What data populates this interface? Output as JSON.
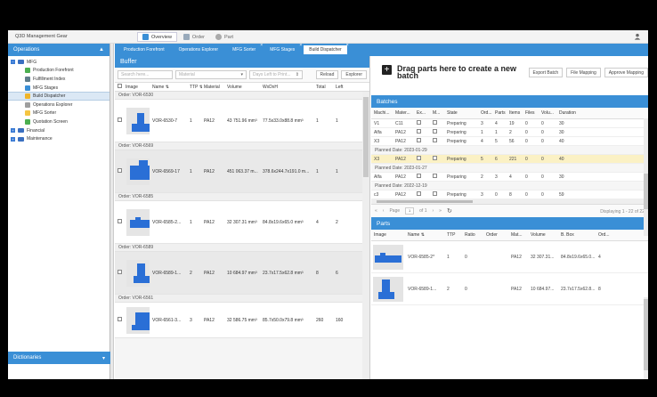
{
  "app_title": "Q3D Management Gear",
  "menu_tabs": [
    {
      "label": "Overview",
      "color": "#3a8fd6"
    },
    {
      "label": "Order",
      "color": "#9ab"
    },
    {
      "label": "Part",
      "color": "#aaa"
    }
  ],
  "sidebar": {
    "header": "Operations",
    "footer": "Dictionaries",
    "tree": [
      {
        "label": "MFG",
        "level": 0,
        "kind": "folder"
      },
      {
        "label": "Production Forefront",
        "level": 1,
        "icon": "#4caf50"
      },
      {
        "label": "Fulfillment Index",
        "level": 1,
        "icon": "#607d8b"
      },
      {
        "label": "MFG Stages",
        "level": 1,
        "icon": "#3a8fd6"
      },
      {
        "label": "Build Dispatcher",
        "level": 1,
        "icon": "#f0b429",
        "selected": true
      },
      {
        "label": "Operations Explorer",
        "level": 1,
        "icon": "#9e9e9e"
      },
      {
        "label": "MFG Sorter",
        "level": 1,
        "icon": "#f5c542"
      },
      {
        "label": "Quotation Screen",
        "level": 1,
        "icon": "#4caf50"
      },
      {
        "label": "Financial",
        "level": 0,
        "kind": "folder"
      },
      {
        "label": "Maintenance",
        "level": 0,
        "kind": "folder"
      }
    ]
  },
  "tabs": [
    {
      "label": "Production Forefront",
      "active": false
    },
    {
      "label": "Operations Explorer",
      "active": false
    },
    {
      "label": "MFG Sorter",
      "active": false
    },
    {
      "label": "MFG Stages",
      "active": false
    },
    {
      "label": "Build Dispatcher",
      "active": true
    }
  ],
  "buffer": {
    "title": "Buffer",
    "search_placeholder": "Search here...",
    "material_placeholder": "Material",
    "days_placeholder": "Days Left to Print...",
    "reload": "Reload",
    "explorer": "Explorer",
    "columns": [
      "Image",
      "Name ⇅",
      "TTP ⇅",
      "Material",
      "Volume",
      "WxDxH",
      "Total",
      "Left"
    ],
    "groups": [
      {
        "order": "Order: VOR-6530",
        "name": "VOR-6530-7",
        "ttp": "1",
        "material": "PA12",
        "volume": "43 751.96 mm³",
        "dims": "77.5x33.0x88.8 mm³",
        "total": "1",
        "left": "1",
        "gray": false
      },
      {
        "order": "Order: VOR-6569",
        "name": "VOR-6569-17",
        "ttp": "1",
        "material": "PA12",
        "volume": "451 063.37 m...",
        "dims": "378.6x244.7x191.0 m...",
        "total": "1",
        "left": "1",
        "gray": true
      },
      {
        "order": "Order: VOR-6585",
        "name": "VOR-6585-2...",
        "ttp": "1",
        "material": "PA12",
        "volume": "32 307.31 mm³",
        "dims": "84.8x19.6x65.0 mm³",
        "total": "4",
        "left": "2",
        "gray": false
      },
      {
        "order": "Order: VOR-6589",
        "name": "VOR-6589-1...",
        "ttp": "2",
        "material": "PA12",
        "volume": "10 684.97 mm³",
        "dims": "23.7x17.5x62.8 mm³",
        "total": "8",
        "left": "6",
        "gray": true
      },
      {
        "order": "Order: VOR-6561",
        "name": "VOR-6561-3...",
        "ttp": "3",
        "material": "PA12",
        "volume": "32 586.75 mm³",
        "dims": "85.7x50.0x79.8 mm³",
        "total": "260",
        "left": "160",
        "gray": false
      }
    ]
  },
  "drag": {
    "text": "Drag parts here to create a new batch",
    "export": "Export Batch",
    "mapping": "File Mapping",
    "approve": "Approve Mapping"
  },
  "batches": {
    "title": "Batches",
    "columns": [
      "Machi...",
      "Mater...",
      "Ex...",
      "M...",
      "State",
      "Ord...",
      "Parts",
      "Items",
      "Files",
      "Volu...",
      "Duration"
    ],
    "rows": [
      {
        "type": "row",
        "cells": [
          "V1",
          "C11",
          "",
          "",
          "Preparing",
          "3",
          "4",
          "19",
          "0",
          "0",
          "30"
        ]
      },
      {
        "type": "row",
        "cells": [
          "Alfa",
          "PA12",
          "",
          "",
          "Preparing",
          "1",
          "1",
          "2",
          "0",
          "0",
          "30"
        ]
      },
      {
        "type": "row",
        "cells": [
          "X3",
          "PA12",
          "",
          "",
          "Preparing",
          "4",
          "5",
          "56",
          "0",
          "0",
          "40"
        ]
      },
      {
        "type": "date",
        "text": "Planned Date: 2023-01-29"
      },
      {
        "type": "row",
        "hl": true,
        "cells": [
          "X3",
          "PA12",
          "",
          "",
          "Preparing",
          "5",
          "6",
          "221",
          "0",
          "0",
          "40"
        ]
      },
      {
        "type": "date",
        "text": "Planned Date: 2023-01-27"
      },
      {
        "type": "row",
        "cells": [
          "Alfa",
          "PA12",
          "",
          "",
          "Preparing",
          "2",
          "3",
          "4",
          "0",
          "0",
          "30"
        ]
      },
      {
        "type": "date",
        "text": "Planned Date: 2022-12-19"
      },
      {
        "type": "row",
        "cells": [
          "c3",
          "PA12",
          "",
          "",
          "Preparing",
          "3",
          "0",
          "8",
          "0",
          "0",
          "59"
        ]
      }
    ],
    "page_label": "Page",
    "page_value": "1",
    "page_of": "of 1",
    "displaying": "Displaying 1 - 22 of 22"
  },
  "parts": {
    "title": "Parts",
    "columns": [
      "Image",
      "Name ⇅",
      "TTP",
      "Ratio",
      "Order",
      "Mat...",
      "Volume",
      "B. Box",
      "Ord..."
    ],
    "rows": [
      {
        "name": "VOR-6585-2*",
        "ttp": "1",
        "ratio": "0",
        "order": "",
        "mat": "PA12",
        "volume": "32 307.31...",
        "bbox": "84.8x19.6x65.0...",
        "ord": "4"
      },
      {
        "name": "VOR-6589-1...",
        "ttp": "2",
        "ratio": "0",
        "order": "",
        "mat": "PA12",
        "volume": "10 684.97...",
        "bbox": "23.7x17.5x62.8...",
        "ord": "8"
      }
    ]
  }
}
